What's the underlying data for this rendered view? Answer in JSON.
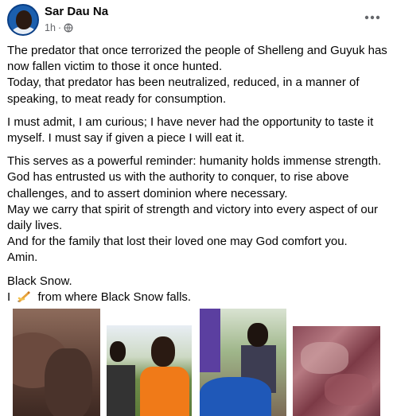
{
  "post": {
    "author": "Sar Dau Na",
    "time": "1h",
    "separator": "·",
    "privacy_icon": "globe-icon",
    "menu_icon": "more-options-icon"
  },
  "content": {
    "paragraphs": [
      [
        "The predator that once terrorized the people of Shelleng and Guyuk has now fallen victim to those it once hunted.",
        "Today, that predator has been neutralized, reduced, in a manner of speaking, to meat ready for consumption."
      ],
      [
        "I must admit, I am curious; I have never had the opportunity to taste it myself. I must say if given a piece I will eat it."
      ],
      [
        "This serves as a powerful reminder: humanity holds immense strength. God has entrusted us with the authority to conquer, to rise above challenges, and to assert dominion where necessary.",
        "May we carry that spirit of strength and victory into every aspect of our daily lives.",
        "And for the family that lost their loved one may God comfort you.",
        "Amin."
      ]
    ],
    "signature_line1": "Black Snow.",
    "signature_line2_prefix": "I",
    "signature_icon": "writing-hand-icon",
    "signature_line2_suffix": "from where Black Snow falls."
  },
  "photos": {
    "count": 4,
    "items": [
      "photo-1",
      "photo-2",
      "photo-3",
      "photo-4"
    ]
  },
  "colors": {
    "text_primary": "#050505",
    "text_secondary": "#65676b",
    "avatar_ring": "#0a3f86"
  }
}
